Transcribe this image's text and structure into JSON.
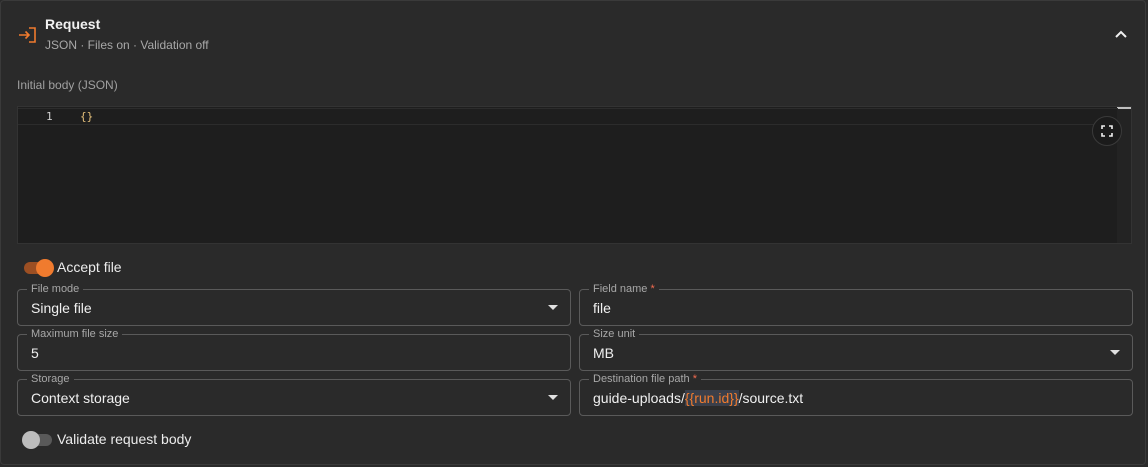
{
  "header": {
    "title": "Request",
    "subtitle": "JSON · Files on · Validation off",
    "icon": "input-arrow-icon",
    "accent_color": "#f07b2e"
  },
  "body_editor": {
    "label": "Initial body (JSON)",
    "line_numbers": [
      "1"
    ],
    "code_lines": [
      "{}"
    ],
    "fullscreen_icon": "fullscreen-icon"
  },
  "accept_file": {
    "label": "Accept file",
    "enabled": true
  },
  "fields": {
    "file_mode": {
      "label": "File mode",
      "value": "Single file",
      "required": false
    },
    "field_name": {
      "label": "Field name",
      "value": "file",
      "required": true,
      "required_mark": "*"
    },
    "max_file_size": {
      "label": "Maximum file size",
      "value": "5",
      "required": false
    },
    "size_unit": {
      "label": "Size unit",
      "value": "MB",
      "required": false
    },
    "storage": {
      "label": "Storage",
      "value": "Context storage",
      "required": false
    },
    "destination_path": {
      "label": "Destination file path",
      "required": true,
      "required_mark": "*",
      "value_prefix": "guide-uploads/",
      "value_token": "{{run.id}}",
      "value_suffix": "/source.txt"
    }
  },
  "validate": {
    "label": "Validate request body",
    "enabled": false
  }
}
